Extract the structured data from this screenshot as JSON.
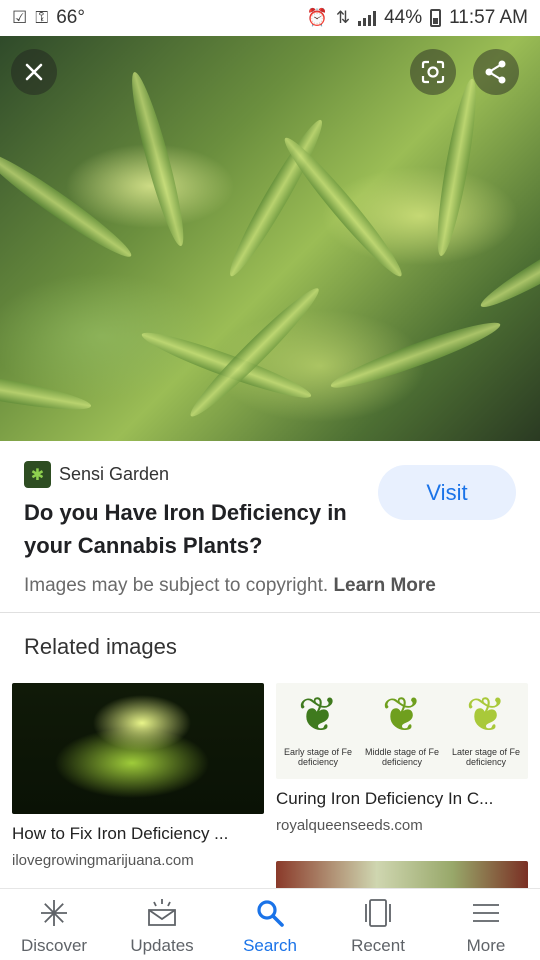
{
  "status_bar": {
    "temperature": "66°",
    "battery": "44%",
    "time": "11:57 AM"
  },
  "image_viewer": {
    "close_icon": "close-icon",
    "lens_icon": "lens-icon",
    "share_icon": "share-icon"
  },
  "result": {
    "source": "Sensi Garden",
    "title": "Do you Have Iron Deficiency in your Cannabis Plants?",
    "visit_label": "Visit",
    "copyright_text": "Images may be subject to copyright.",
    "learn_more": "Learn More"
  },
  "related": {
    "heading": "Related images",
    "items": [
      {
        "title": "How to Fix Iron Deficiency ...",
        "domain": "ilovegrowingmarijuana.com"
      },
      {
        "title": "Curing Iron Deficiency In C...",
        "domain": "royalqueenseeds.com",
        "captions": [
          "Early stage of Fe deficiency",
          "Middle stage of Fe deficiency",
          "Later stage of Fe deficiency"
        ]
      }
    ]
  },
  "bottom_nav": [
    {
      "label": "Discover",
      "icon": "asterisk-icon",
      "active": false
    },
    {
      "label": "Updates",
      "icon": "updates-icon",
      "active": false
    },
    {
      "label": "Search",
      "icon": "search-icon",
      "active": true
    },
    {
      "label": "Recent",
      "icon": "recent-icon",
      "active": false
    },
    {
      "label": "More",
      "icon": "menu-icon",
      "active": false
    }
  ],
  "colors": {
    "accent": "#1a73e8",
    "visit_bg": "#e8f0fe"
  }
}
